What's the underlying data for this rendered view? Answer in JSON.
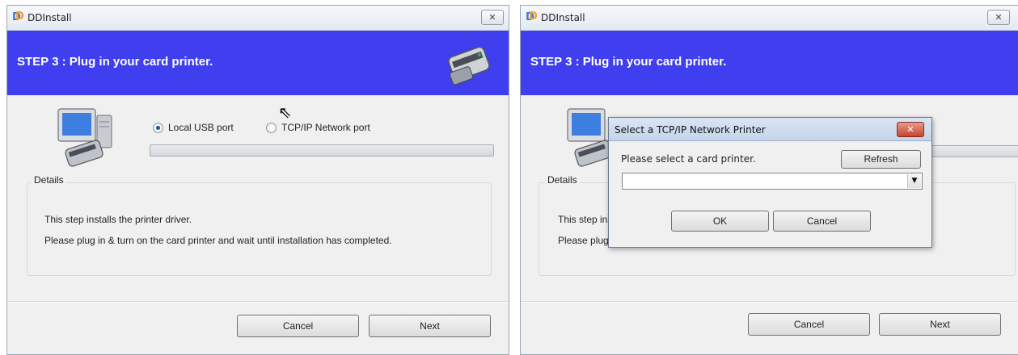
{
  "left_window": {
    "title": "DDInstall",
    "close_glyph": "✕",
    "step_title": "STEP 3 :  Plug in your card printer.",
    "port_options": [
      {
        "label": "Local USB port",
        "selected": true
      },
      {
        "label": "TCP/IP Network port",
        "selected": false
      }
    ],
    "progress_fraction": 0,
    "details": {
      "legend": "Details",
      "line1": "This step installs the printer driver.",
      "line2": "Please plug in & turn on the card printer and wait until installation has completed."
    },
    "buttons": {
      "cancel": "Cancel",
      "next": "Next"
    }
  },
  "right_window": {
    "title": "DDInstall",
    "close_glyph": "✕",
    "step_title": "STEP 3 :  Plug in your card printer.",
    "details": {
      "legend": "Details",
      "line1_partial": "This step ins",
      "line2_partial": "Please plug"
    },
    "buttons": {
      "cancel": "Cancel",
      "next": "Next"
    }
  },
  "dialog": {
    "title": "Select a TCP/IP Network Printer",
    "close_glyph": "✕",
    "prompt": "Please select a card printer.",
    "refresh_label": "Refresh",
    "selected_printer": "",
    "dropdown_glyph": "▼",
    "ok_label": "OK",
    "cancel_label": "Cancel"
  },
  "colors": {
    "banner": "#3f3ff0",
    "window_bg": "#f0f0f0",
    "dialog_close": "#c64330"
  },
  "icons": {
    "app": "ddinstall-app-icon",
    "banner": "card-printer-icon",
    "illustration": "computer-with-card-printer-icon",
    "cursor": "mouse-pointer-icon"
  }
}
